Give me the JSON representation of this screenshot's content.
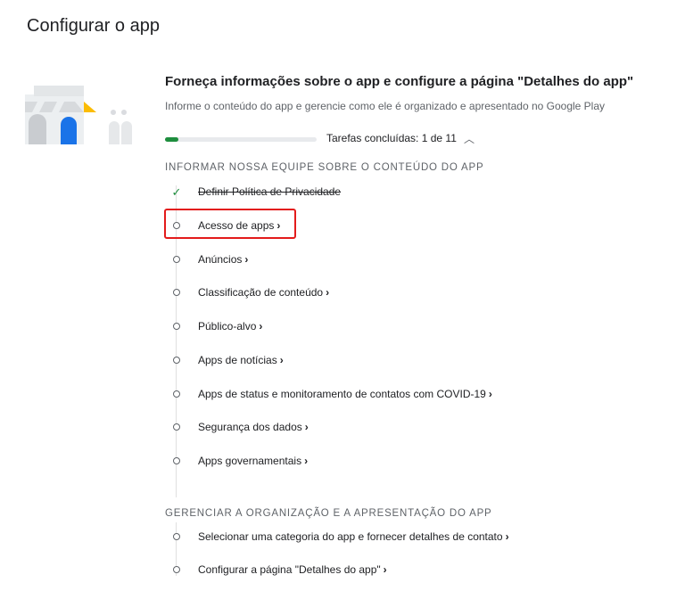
{
  "page_title": "Configurar o app",
  "setup": {
    "heading": "Forneça informações sobre o app e configure a página \"Detalhes do app\"",
    "description": "Informe o conteúdo do app e gerencie como ele é organizado e apresentado no Google Play",
    "progress_label": "Tarefas concluídas: 1 de 11",
    "progress_fraction": 0.0909
  },
  "sections": [
    {
      "title": "INFORMAR NOSSA EQUIPE SOBRE O CONTEÚDO DO APP",
      "tasks": [
        {
          "label": "Definir Política de Privacidade",
          "done": true
        },
        {
          "label": "Acesso de apps",
          "done": false
        },
        {
          "label": "Anúncios",
          "done": false
        },
        {
          "label": "Classificação de conteúdo",
          "done": false
        },
        {
          "label": "Público-alvo",
          "done": false
        },
        {
          "label": "Apps de notícias",
          "done": false
        },
        {
          "label": "Apps de status e monitoramento de contatos com COVID-19",
          "done": false
        },
        {
          "label": "Segurança dos dados",
          "done": false
        },
        {
          "label": "Apps governamentais",
          "done": false
        }
      ]
    },
    {
      "title": "GERENCIAR A ORGANIZAÇÃO E A APRESENTAÇÃO DO APP",
      "tasks": [
        {
          "label": "Selecionar uma categoria do app e fornecer detalhes de contato",
          "done": false
        },
        {
          "label": "Configurar a página \"Detalhes do app\"",
          "done": false
        }
      ]
    }
  ],
  "colors": {
    "accent_green": "#1e8e3e",
    "highlight_red": "#e31b1b",
    "blue": "#1a73e8",
    "yellow": "#fbbc04"
  },
  "icons": {
    "collapse": "chevron-up-icon",
    "done": "check-icon",
    "pending": "circle-icon",
    "link": "chevron-right-icon"
  }
}
